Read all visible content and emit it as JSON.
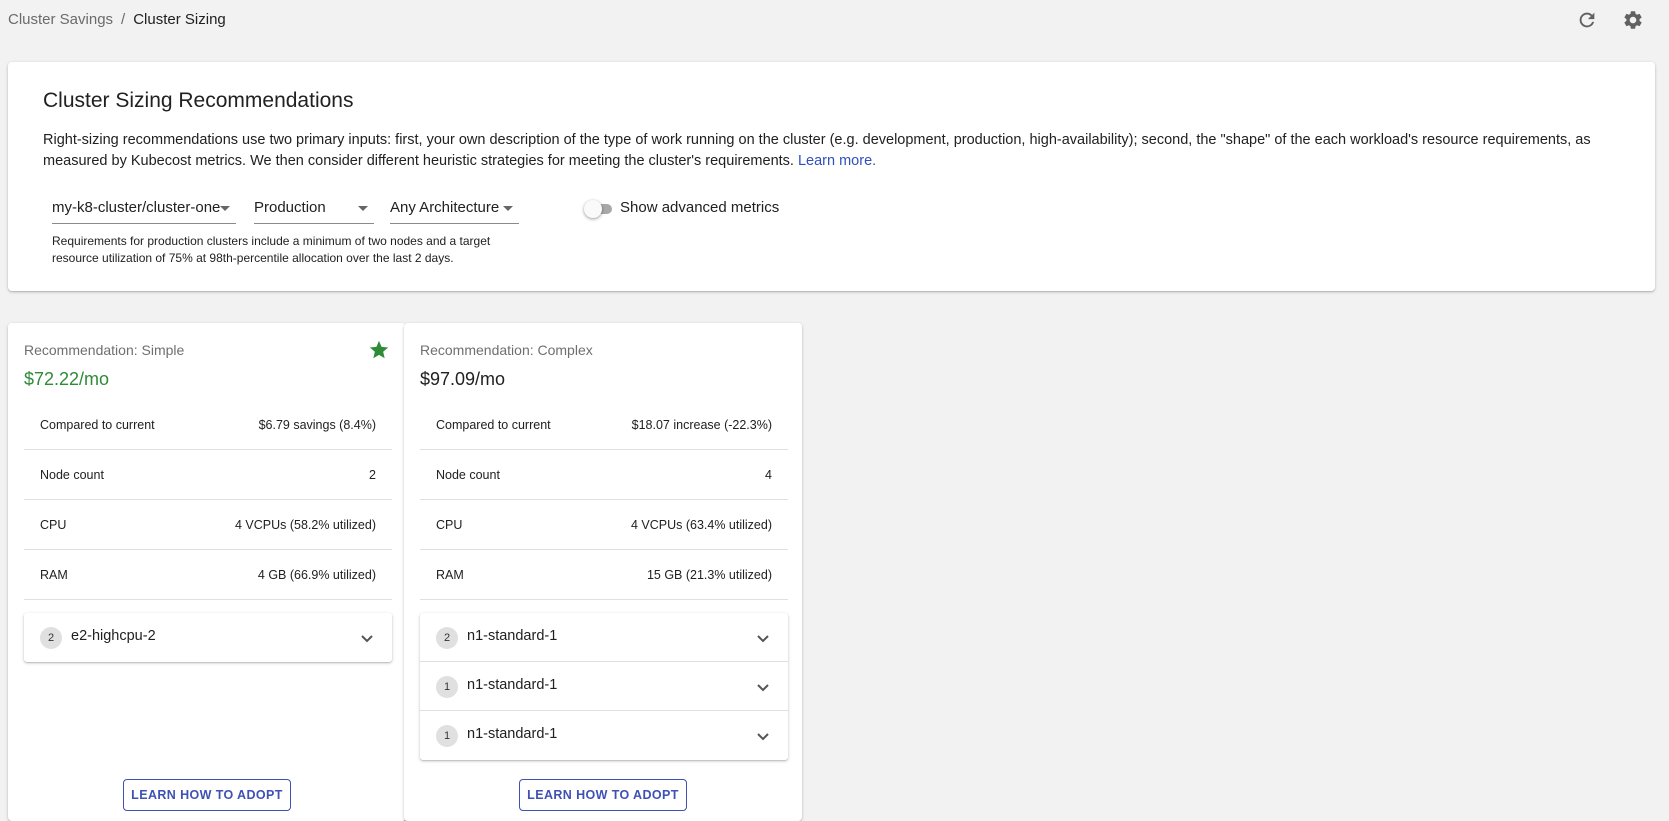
{
  "breadcrumb": {
    "parent": "Cluster Savings",
    "separator": "/",
    "current": "Cluster Sizing"
  },
  "toolbar": {
    "refresh_icon": "refresh-icon",
    "settings_icon": "gear-icon"
  },
  "header": {
    "title": "Cluster Sizing Recommendations",
    "description": "Right-sizing recommendations use two primary inputs: first, your own description of the type of work running on the cluster (e.g. development, production, high-availability); second, the \"shape\" of the each workload's resource requirements, as measured by Kubecost metrics. We then consider different heuristic strategies for meeting the cluster's requirements.",
    "learn_more": "Learn more.",
    "cluster_select": "my-k8-cluster/cluster-one",
    "profile_select": "Production",
    "architecture_select": "Any Architecture",
    "helper_text": "Requirements for production clusters include a minimum of two nodes and a target resource utilization of 75% at 98th-percentile allocation over the last 2 days.",
    "advanced_toggle_label": "Show advanced metrics",
    "advanced_toggle_on": false
  },
  "recommendations": [
    {
      "title": "Recommendation: Simple",
      "price": "$72.22/mo",
      "recommended": true,
      "metrics": [
        {
          "label": "Compared to current",
          "value": "$6.79 savings (8.4%)"
        },
        {
          "label": "Node count",
          "value": "2"
        },
        {
          "label": "CPU",
          "value": "4 VCPUs (58.2% utilized)"
        },
        {
          "label": "RAM",
          "value": "4 GB (66.9% utilized)"
        }
      ],
      "nodes": [
        {
          "count": "2",
          "name": "e2-highcpu-2"
        }
      ],
      "button": "LEARN HOW TO ADOPT"
    },
    {
      "title": "Recommendation: Complex",
      "price": "$97.09/mo",
      "recommended": false,
      "metrics": [
        {
          "label": "Compared to current",
          "value": "$18.07 increase (-22.3%)"
        },
        {
          "label": "Node count",
          "value": "4"
        },
        {
          "label": "CPU",
          "value": "4 VCPUs (63.4% utilized)"
        },
        {
          "label": "RAM",
          "value": "15 GB (21.3% utilized)"
        }
      ],
      "nodes": [
        {
          "count": "2",
          "name": "n1-standard-1"
        },
        {
          "count": "1",
          "name": "n1-standard-1"
        },
        {
          "count": "1",
          "name": "n1-standard-1"
        }
      ],
      "button": "LEARN HOW TO ADOPT"
    }
  ],
  "colors": {
    "accent": "#3f51b5",
    "savings_green": "#2e8b36",
    "link": "#2f4fc0"
  }
}
